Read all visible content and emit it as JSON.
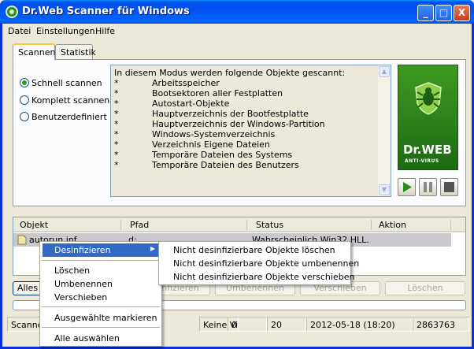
{
  "window": {
    "title": "Dr.Web Scanner für Windows",
    "btn_min": "_",
    "btn_max": "□",
    "btn_close": "X"
  },
  "menu": [
    "Datei",
    "Einstellungen",
    "Hilfe"
  ],
  "tabs": [
    "Scannen",
    "Statistik"
  ],
  "scan_modes": [
    {
      "label": "Schnell scannen",
      "selected": true
    },
    {
      "label": "Komplett scannen",
      "selected": false
    },
    {
      "label": "Benutzerdefiniert",
      "selected": false
    }
  ],
  "info": {
    "heading": "In diesem Modus werden folgende Objekte gescannt:",
    "bullet": "*",
    "items": [
      "Arbeitsspeicher",
      "Bootsektoren aller Festplatten",
      "Autostart-Objekte",
      "Hauptverzeichnis der Bootfestplatte",
      "Hauptverzeichnis der Windows-Partition",
      "Windows-Systemverzeichnis",
      "Verzeichnis Eigene Dateien",
      "Temporäre Dateien des Systems",
      "Temporäre Dateien des Benutzers"
    ]
  },
  "logo": {
    "brand": "Dr.WEB",
    "sub": "ANTI-VIRUS"
  },
  "controls": {
    "play": "▶",
    "pause": "❚❚",
    "stop": "■"
  },
  "results": {
    "columns": [
      "Objekt",
      "Pfad",
      "Status",
      "Aktion"
    ],
    "rows": [
      {
        "object": "autorun.inf",
        "path": "d:",
        "status": "Wahrscheinlich Win32.HLL...",
        "action": ""
      }
    ]
  },
  "actions": {
    "select_all": "Alles",
    "disinfect": "Desinfizieren",
    "rename": "Umbenennen",
    "move": "Verschieben",
    "delete": "Löschen"
  },
  "status": {
    "scanner": "Scanner",
    "viruses": "Keine Viren gefun",
    "count1": "0",
    "count2": "20",
    "datetime": "2012-05-18 (18:20)",
    "number": "2863763"
  },
  "context_menu": {
    "items": [
      "Desinfizieren",
      "Löschen",
      "Umbenennen",
      "Verschieben",
      "Ausgewählte markieren",
      "Alle auswählen"
    ],
    "submenu_arrow": "▶"
  },
  "submenu": {
    "items": [
      "Nicht desinfizierbare Objekte löschen",
      "Nicht desinfizierbare Objekte umbenennen",
      "Nicht desinfizierbare Objekte verschieben"
    ]
  }
}
